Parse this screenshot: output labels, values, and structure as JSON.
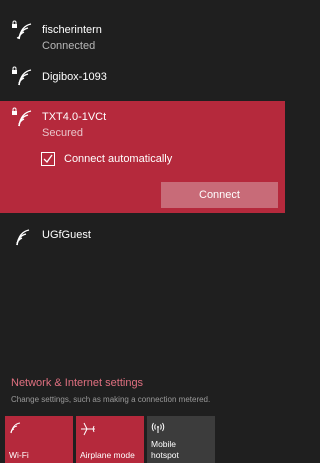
{
  "colors": {
    "background": "#1f1f1f",
    "accent": "#b5293c",
    "connect_button": "#c86b78",
    "settings_link": "#e07080",
    "tile_inactive": "#3c3c3c"
  },
  "networks": [
    {
      "name": "fischerintern",
      "status": "Connected",
      "icon": "wifi-secured-icon"
    },
    {
      "name": "Digibox-1093",
      "icon": "wifi-secured-icon"
    },
    {
      "name": "TXT4.0-1VCt",
      "status": "Secured",
      "icon": "wifi-secured-icon",
      "selected": true,
      "connect_automatically": {
        "label": "Connect automatically",
        "checked": true
      },
      "connect_button": "Connect"
    },
    {
      "name": "UGfGuest",
      "icon": "wifi-open-icon"
    }
  ],
  "settings": {
    "title": "Network & Internet settings",
    "description": "Change settings, such as making a connection metered."
  },
  "quick_actions": [
    {
      "label": "Wi-Fi",
      "icon": "wifi-icon",
      "active": true
    },
    {
      "label": "Airplane mode",
      "icon": "airplane-icon",
      "active": true
    },
    {
      "label": "Mobile\nhotspot",
      "icon": "hotspot-icon",
      "active": false
    }
  ]
}
